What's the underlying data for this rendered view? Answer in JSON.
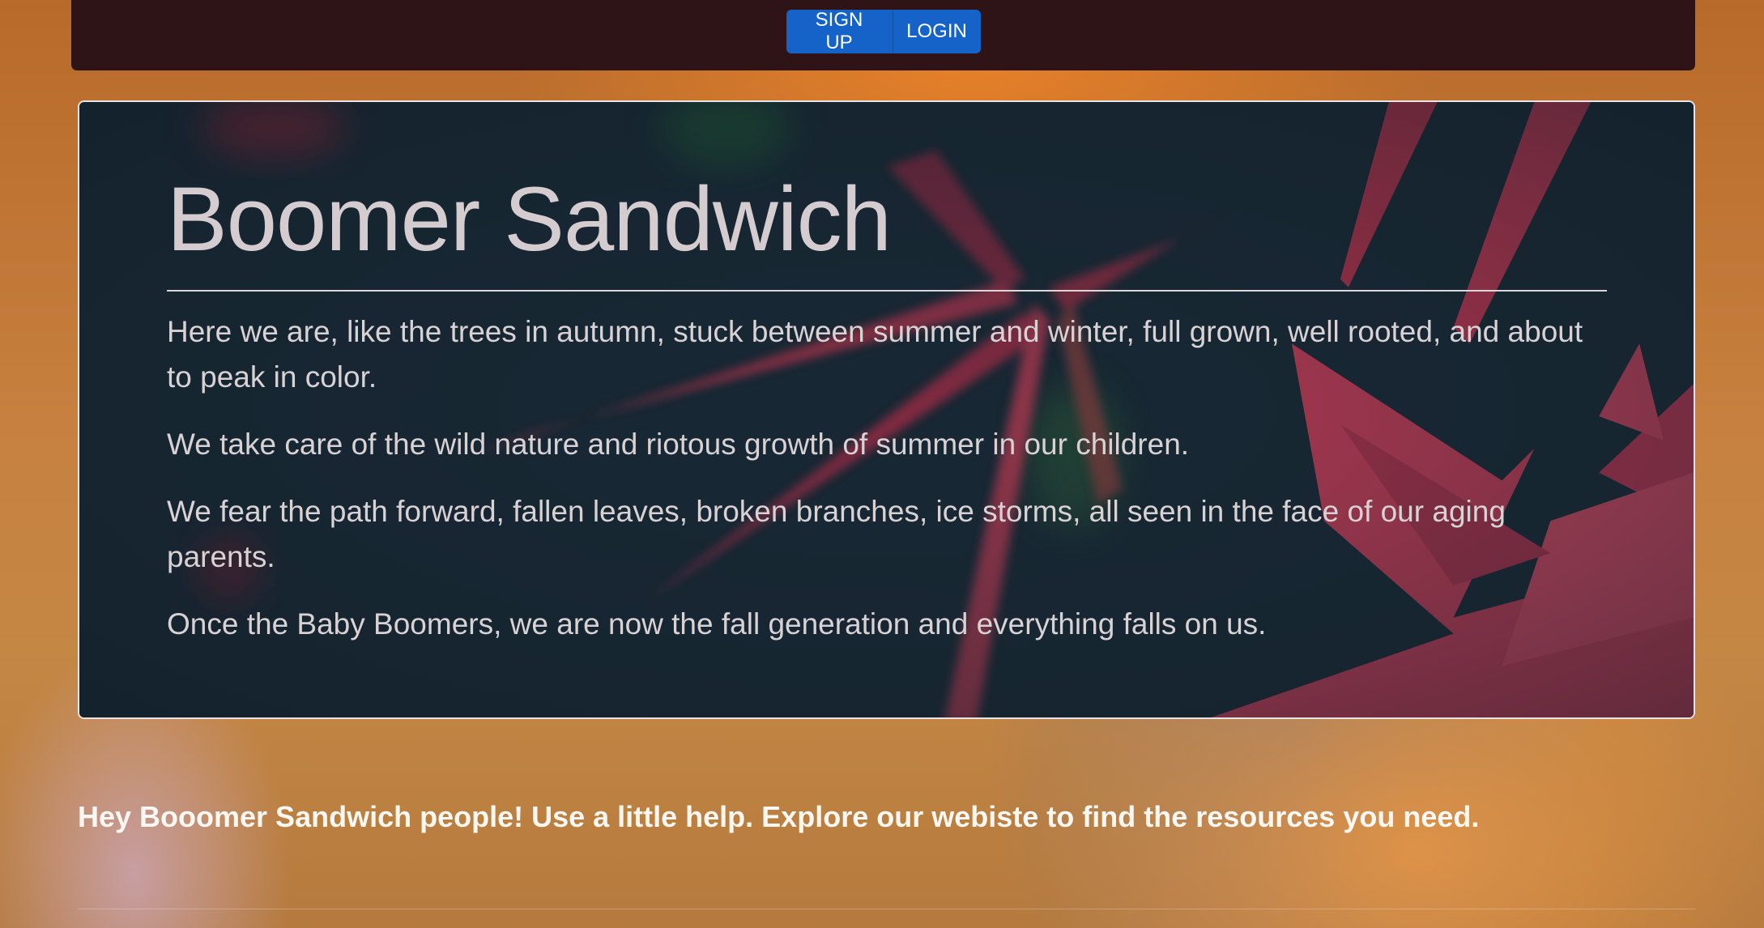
{
  "navbar": {
    "signup_label": "SIGN UP",
    "login_label": "LOGIN"
  },
  "hero": {
    "title": "Boomer Sandwich",
    "paragraphs": [
      "Here we are, like the trees in autumn, stuck between summer and winter, full grown, well rooted, and about to peak in color.",
      "We take care of the wild nature and riotous growth of summer in our children.",
      "We fear the path forward, fallen leaves, broken branches, ice storms, all seen in the face of our aging parents.",
      "Once the Baby Boomers, we are now the fall generation and everything falls on us."
    ]
  },
  "tagline": "Hey Booomer Sandwich people! Use a little help. Explore our webiste to find the resources you need.",
  "colors": {
    "navbar_bg": "#2e1416",
    "button_bg": "#1563c9",
    "hero_bg": "#162632",
    "leaf_red": "#c8344e"
  }
}
